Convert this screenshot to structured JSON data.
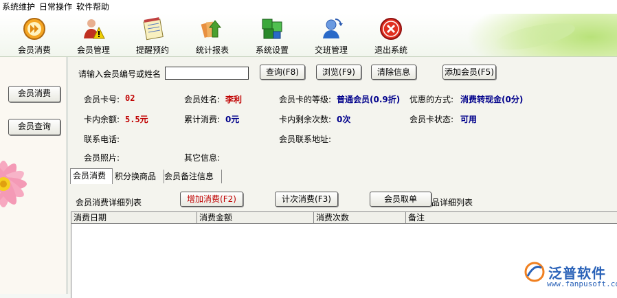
{
  "menu": [
    "系统维护",
    "日常操作",
    "软件帮助"
  ],
  "toolbar": [
    {
      "label": "会员消费",
      "icon": "fast-forward-icon",
      "color": "#f5a623"
    },
    {
      "label": "会员管理",
      "icon": "member-warning-icon",
      "color": "#d04020"
    },
    {
      "label": "提醒预约",
      "icon": "notepad-icon",
      "color": "#e8c85a"
    },
    {
      "label": "统计报表",
      "icon": "report-arrow-icon",
      "color": "#5aa83a"
    },
    {
      "label": "系统设置",
      "icon": "settings-cubes-icon",
      "color": "#3aa83a"
    },
    {
      "label": "交班管理",
      "icon": "shift-handover-icon",
      "color": "#2a6ac8"
    },
    {
      "label": "退出系统",
      "icon": "exit-icon",
      "color": "#e03020"
    }
  ],
  "sidebar": {
    "btn1": "会员消费",
    "btn2": "会员查询"
  },
  "search": {
    "label": "请输入会员编号或姓名",
    "value": "",
    "query": "查询(F8)",
    "browse": "浏览(F9)",
    "clear": "清除信息",
    "add": "添加会员(F5)"
  },
  "info": {
    "card_no_label": "会员卡号:",
    "card_no": "02",
    "name_label": "会员姓名:",
    "name": "李利",
    "level_label": "会员卡的等级:",
    "level": "普通会员(0.9折)",
    "discount_label": "优惠的方式:",
    "discount": "消费转现金(0分)",
    "balance_label": "卡内余额:",
    "balance": "5.5元",
    "total_label": "累计消费:",
    "total": "0元",
    "remain_label": "卡内剩余次数:",
    "remain": "0次",
    "status_label": "会员卡状态:",
    "status": "可用",
    "phone_label": "联系电话:",
    "address_label": "会员联系地址:",
    "photo_label": "会员照片:",
    "other_label": "其它信息:"
  },
  "tabs": [
    "会员消费",
    "积分换商品",
    "会员备注信息"
  ],
  "detail": {
    "title": "会员消费详细列表",
    "add": "增加消费(F2)",
    "count": "计次消费(F3)",
    "cancel": "会员取单",
    "tail": "品详细列表"
  },
  "grid_columns": [
    "消费日期",
    "消费金额",
    "消费次数",
    "备注"
  ],
  "watermark": {
    "name": "泛普软件",
    "url": "www.fanpusoft.com"
  }
}
